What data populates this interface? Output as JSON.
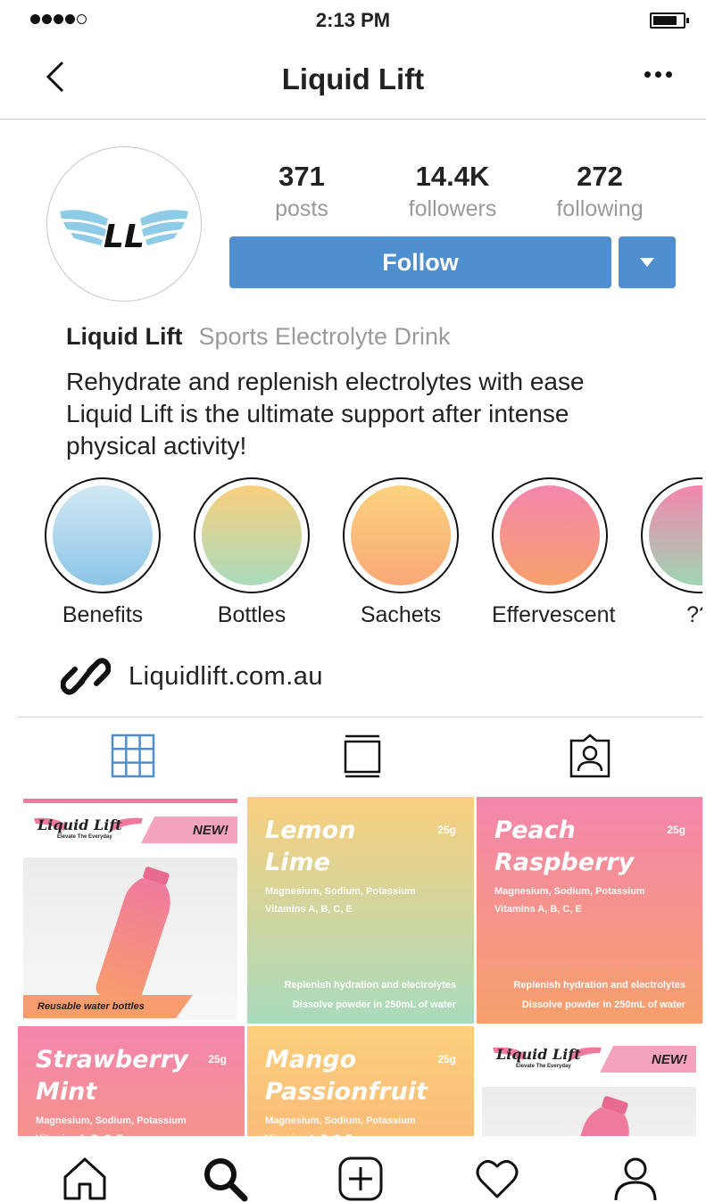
{
  "status_bar": {
    "time": "2:13 PM"
  },
  "nav": {
    "title": "Liquid Lift"
  },
  "profile": {
    "stats": [
      {
        "value": "371",
        "label": "posts"
      },
      {
        "value": "14.4K",
        "label": "followers"
      },
      {
        "value": "272",
        "label": "following"
      }
    ],
    "follow_label": "Follow",
    "name": "Liquid Lift",
    "category": "Sports Electrolyte Drink",
    "bio_lines": [
      "Rehydrate and replenish electrolytes with ease",
      "Liquid Lift is the ultimate support after intense",
      "physical activity!"
    ],
    "avatar_text": "LL",
    "website": "Liquidlift.com.au"
  },
  "highlights": [
    {
      "label": "Benefits",
      "color_top": "#d2e8f4",
      "color_bottom": "#8cc5e6"
    },
    {
      "label": "Bottles",
      "color_top": "#f9cf7e",
      "color_bottom": "#a9dbbd"
    },
    {
      "label": "Sachets",
      "color_top": "#fbd27e",
      "color_bottom": "#f9a977"
    },
    {
      "label": "Effervescent",
      "color_top": "#f386ad",
      "color_bottom": "#f7a06b"
    },
    {
      "label": "??",
      "color_top": "#f386ad",
      "color_bottom": "#9fd5b4"
    }
  ],
  "tabs": [
    "grid-tab",
    "feed-tab",
    "tagged-tab"
  ],
  "posts": [
    {
      "kind": "brand",
      "logo": "Liquid Lift",
      "tagline": "Elevate The Everyday",
      "badge": "NEW!",
      "ribbon": "Reusable water bottles"
    },
    {
      "kind": "flavour",
      "name": "Lemon\nLime",
      "weight": "25g",
      "ingredients": "Magnesium, Sodium, Potassium\nVitamins A, B, C, E",
      "footer": "Replenish hydration and electrolytes\nDissolve powder in 250mL of water",
      "color_top": "#f9cf7e",
      "color_bottom": "#a9dbbd"
    },
    {
      "kind": "flavour",
      "name": "Peach\nRaspberry",
      "weight": "25g",
      "ingredients": "Magnesium, Sodium, Potassium\nVitamins A, B, C, E",
      "footer": "Replenish hydration and electrolytes\nDissolve powder in 250mL of water",
      "color_top": "#f386ad",
      "color_bottom": "#f7a06b"
    },
    {
      "kind": "flavour",
      "name": "Strawberry\nMint",
      "weight": "25g",
      "ingredients": "Magnesium, Sodium, Potassium\nVitamins A, B, C, E",
      "footer": "",
      "color_top": "#f386ad",
      "color_bottom": "#f7a06b"
    },
    {
      "kind": "flavour",
      "name": "Mango\nPassionfruit",
      "weight": "25g",
      "ingredients": "Magnesium, Sodium, Potassium\nVitamins A, B, C, E",
      "footer": "",
      "color_top": "#fbcf7c",
      "color_bottom": "#f9a977"
    },
    {
      "kind": "brand",
      "logo": "Liquid Lift",
      "tagline": "Elevate The Everyday",
      "badge": "NEW!",
      "ribbon": ""
    }
  ],
  "colors": {
    "accent": "#4f8fd0",
    "divider": "#cfcfcf"
  }
}
